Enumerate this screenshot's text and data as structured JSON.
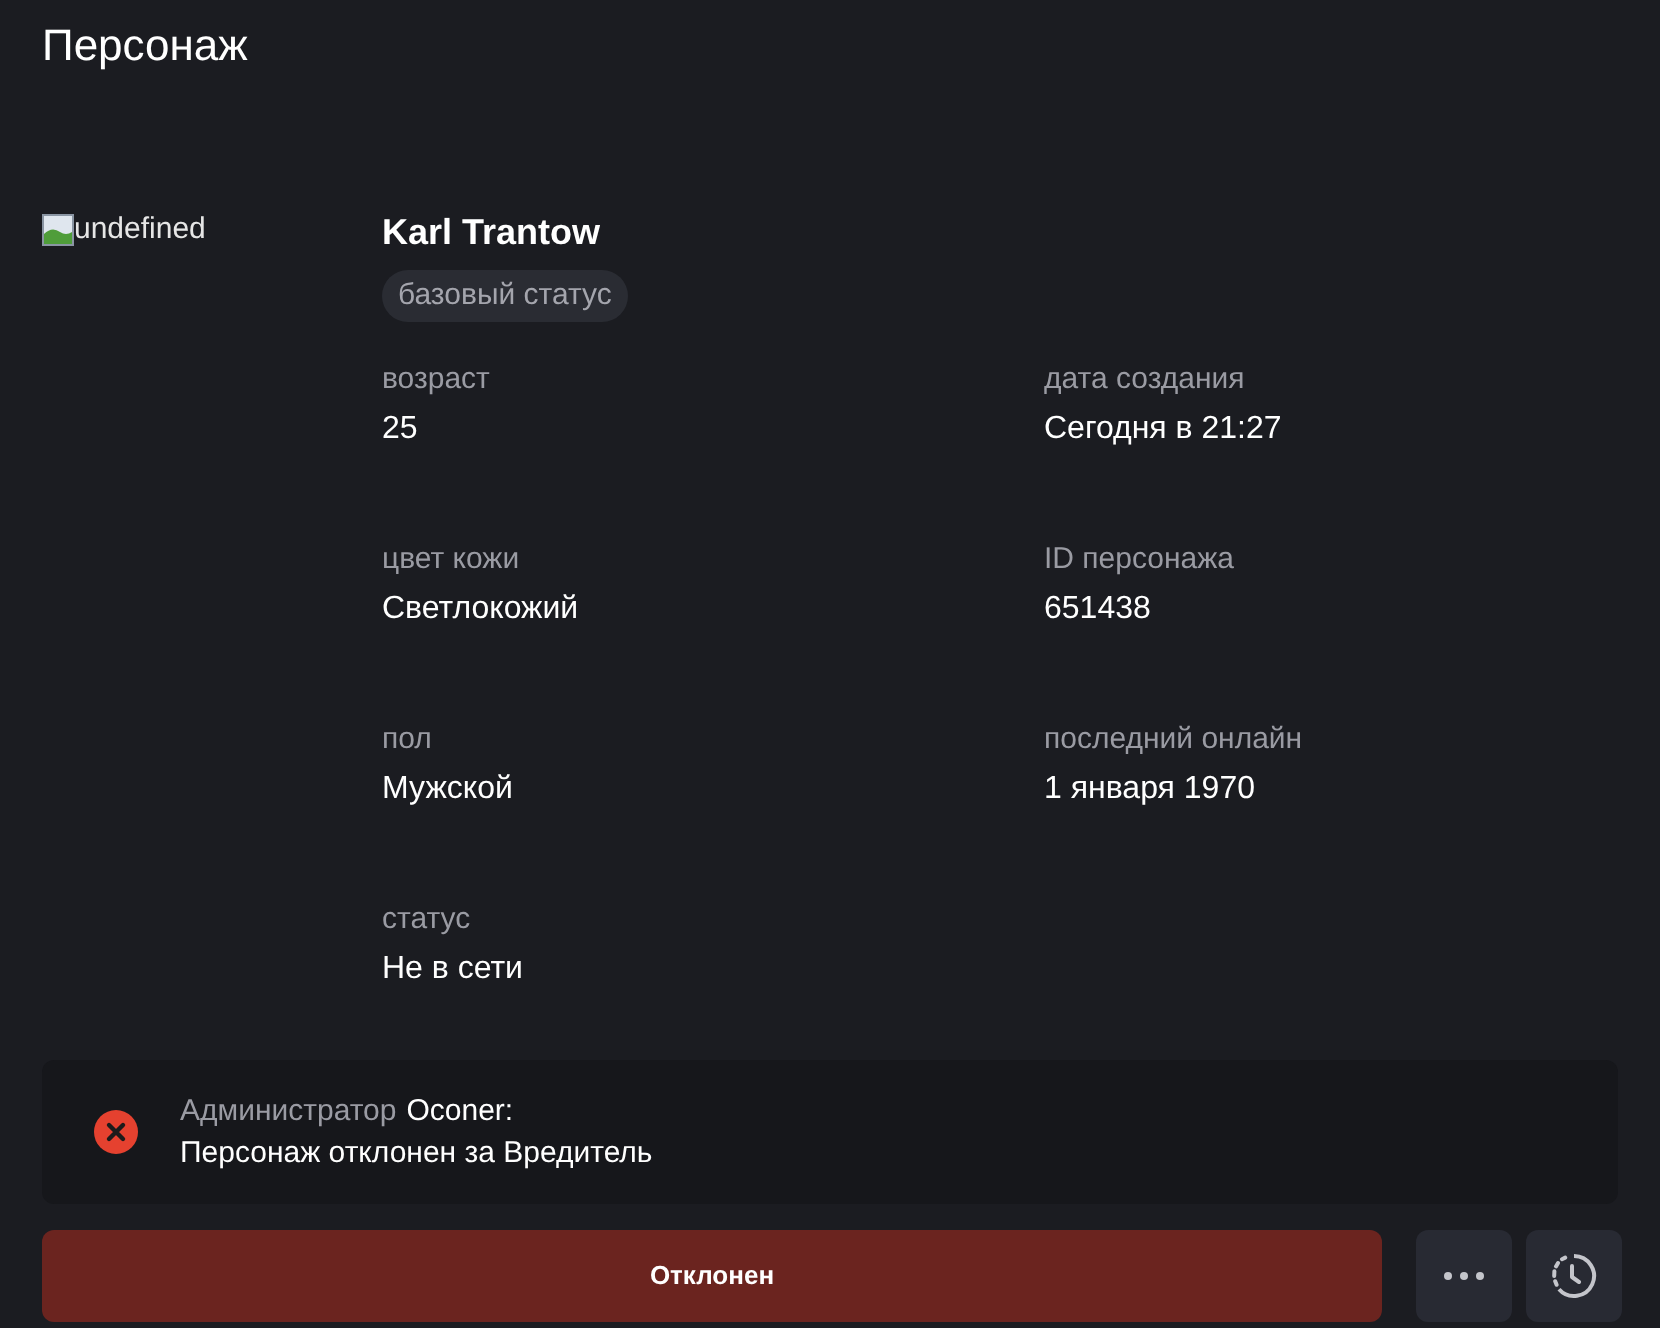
{
  "page": {
    "title": "Персонаж"
  },
  "character": {
    "avatar": {
      "alt": "undefined"
    },
    "name": "Karl Trantow",
    "badge": "базовый статус",
    "fields": [
      {
        "label": "возраст",
        "value": "25"
      },
      {
        "label": "дата создания",
        "value": "Сегодня в 21:27"
      },
      {
        "label": "цвет кожи",
        "value": "Светлокожий"
      },
      {
        "label": "ID персонажа",
        "value": "651438"
      },
      {
        "label": "пол",
        "value": "Мужской"
      },
      {
        "label": "последний онлайн",
        "value": "1 января 1970"
      },
      {
        "label": "статус",
        "value": "Не в сети"
      }
    ]
  },
  "notice": {
    "rejected": true,
    "role": "Администратор",
    "author": "Oconer:",
    "message": "Персонаж отклонен за Вредитель"
  },
  "actions": {
    "status_button": {
      "label": "Отклонен",
      "rejected": true
    }
  }
}
